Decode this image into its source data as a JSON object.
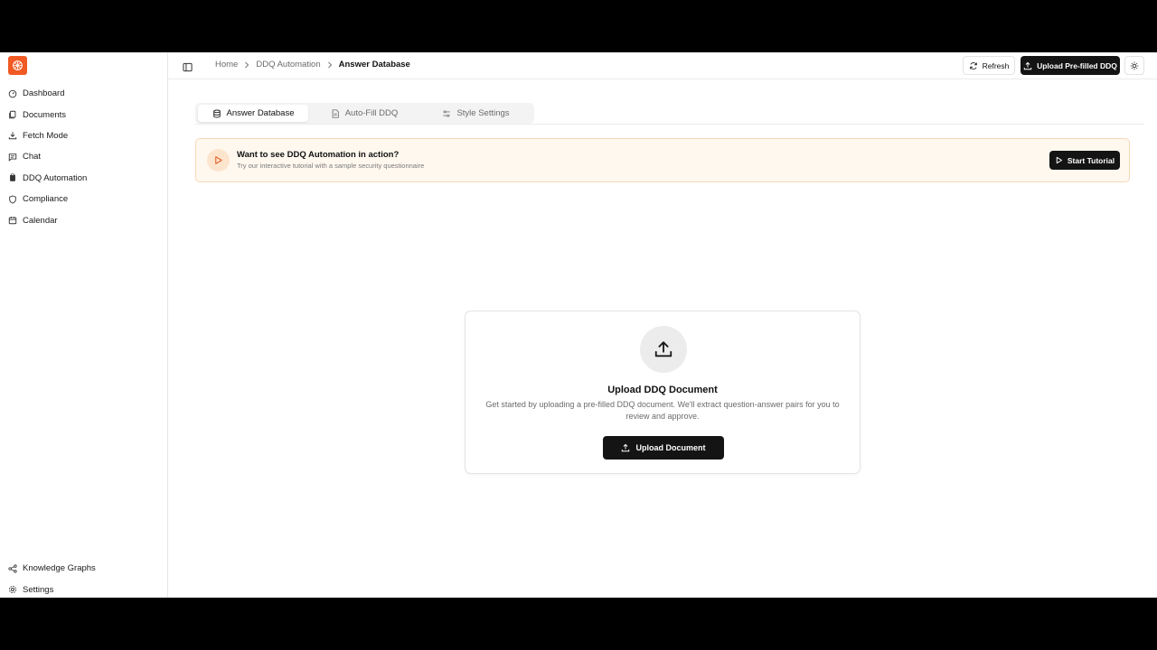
{
  "sidebar": {
    "items": [
      {
        "label": "Dashboard",
        "icon": "gauge-icon"
      },
      {
        "label": "Documents",
        "icon": "documents-icon"
      },
      {
        "label": "Fetch Mode",
        "icon": "download-icon"
      },
      {
        "label": "Chat",
        "icon": "chat-icon"
      },
      {
        "label": "DDQ Automation",
        "icon": "clipboard-icon"
      },
      {
        "label": "Compliance",
        "icon": "shield-icon"
      },
      {
        "label": "Calendar",
        "icon": "calendar-icon"
      }
    ],
    "bottom_items": [
      {
        "label": "Knowledge Graphs",
        "icon": "graph-icon"
      },
      {
        "label": "Settings",
        "icon": "gear-icon"
      }
    ]
  },
  "header": {
    "breadcrumb": [
      "Home",
      "DDQ Automation",
      "Answer Database"
    ],
    "refresh_label": "Refresh",
    "upload_label": "Upload Pre-filled DDQ"
  },
  "tabs": [
    {
      "label": "Answer Database",
      "active": true
    },
    {
      "label": "Auto-Fill DDQ",
      "active": false
    },
    {
      "label": "Style Settings",
      "active": false
    }
  ],
  "banner": {
    "title": "Want to see DDQ Automation in action?",
    "subtitle": "Try our interactive tutorial with a sample security questionnaire",
    "button_label": "Start Tutorial"
  },
  "upload_card": {
    "title": "Upload DDQ Document",
    "description": "Get started by uploading a pre-filled DDQ document. We'll extract question-answer pairs for you to review and approve.",
    "button_label": "Upload Document"
  },
  "colors": {
    "brand": "#f25a24",
    "primary_button": "#141414",
    "banner_bg": "#fff8ef",
    "banner_border": "#f6d9b8"
  }
}
